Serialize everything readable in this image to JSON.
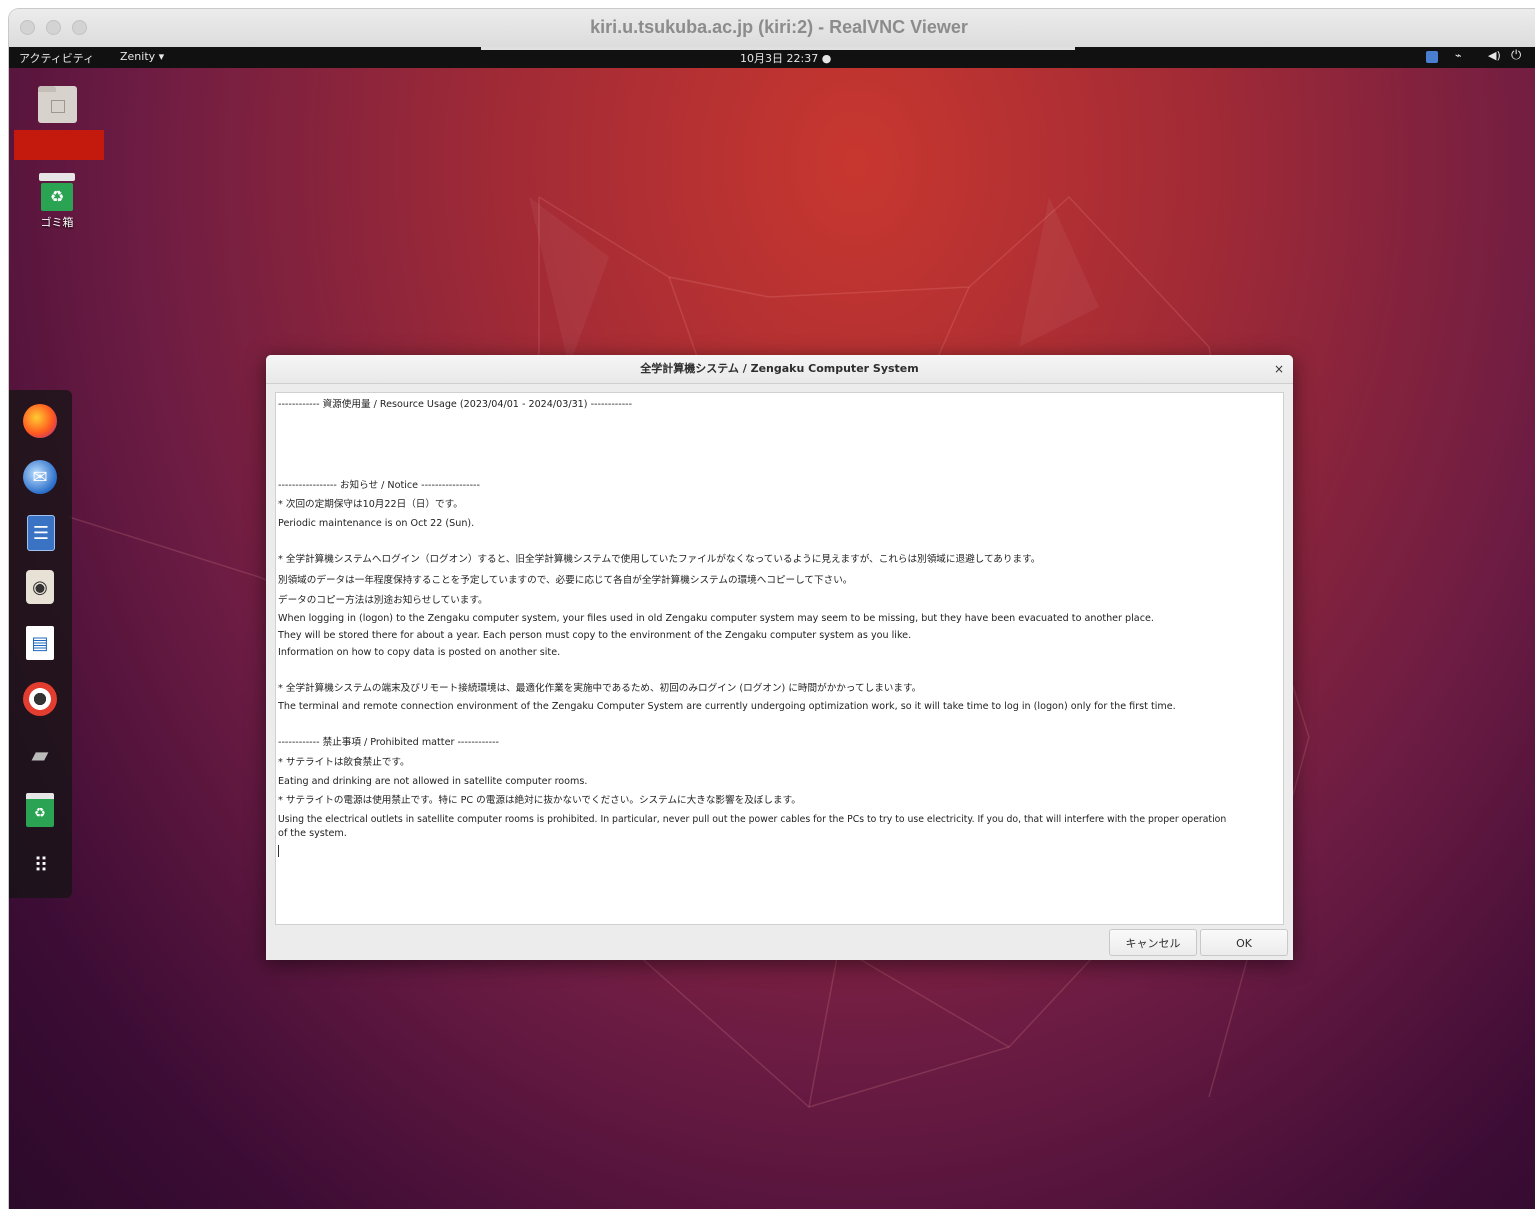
{
  "window": {
    "title": "kiri.u.tsukuba.ac.jp (kiri:2) - RealVNC Viewer"
  },
  "topbar": {
    "activities": "アクティビティ",
    "app_menu": "Zenity ▾",
    "clock": "10月3日 22:37  ●"
  },
  "desktop": {
    "trash_label": "ゴミ箱"
  },
  "dock": {
    "icons": [
      "firefox-icon",
      "thunderbird-icon",
      "files-icon",
      "rhythmbox-icon",
      "writer-icon",
      "help-icon",
      "usb-drive-icon",
      "trash-icon",
      "app-grid-icon"
    ]
  },
  "dialog": {
    "title": "全学計算機システム / Zengaku Computer System",
    "close": "×",
    "lines": [
      "------------ 資源使用量 / Resource Usage (2023/04/01 - 2024/03/31) ------------",
      "----------------- お知らせ / Notice -----------------",
      "* 次回の定期保守は10月22日（日）です。",
      "   Periodic maintenance is on Oct 22 (Sun).",
      "* 全学計算機システムへログイン（ログオン）すると、旧全学計算機システムで使用していたファイルがなくなっているように見えますが、これらは別領域に退避してあります。",
      " 別領域のデータは一年程度保持することを予定していますので、必要に応じて各自が全学計算機システムの環境へコピーして下さい。",
      " データのコピー方法は別途お知らせしています。",
      " When logging in (logon) to the Zengaku computer system, your files used in old Zengaku computer system may seem to be missing, but they have been evacuated to another place.",
      " They will be stored there for about a year. Each person must copy to the environment of the Zengaku computer system as you like.",
      " Information on how to copy data is posted on another site.",
      "* 全学計算機システムの端末及びリモート接続環境は、最適化作業を実施中であるため、初回のみログイン (ログオン) に時間がかかってしまいます。",
      " The terminal and remote connection environment of the Zengaku Computer System are currently undergoing optimization work, so it will take time to log in (logon) only for the first time.",
      "------------ 禁止事項 / Prohibited matter ------------",
      "* サテライトは飲食禁止です。",
      "   Eating and drinking are not allowed in satellite computer rooms.",
      "* サテライトの電源は使用禁止です。特に PC の電源は絶対に抜かないでください。システムに大きな影響を及ぼします。",
      "   Using the electrical outlets in satellite computer rooms is prohibited. In particular, never pull out the power cables for the PCs to try to use electricity. If you do, that will interfere with the proper operation",
      "of the system."
    ],
    "cancel_label": "キャンセル",
    "ok_label": "OK"
  }
}
